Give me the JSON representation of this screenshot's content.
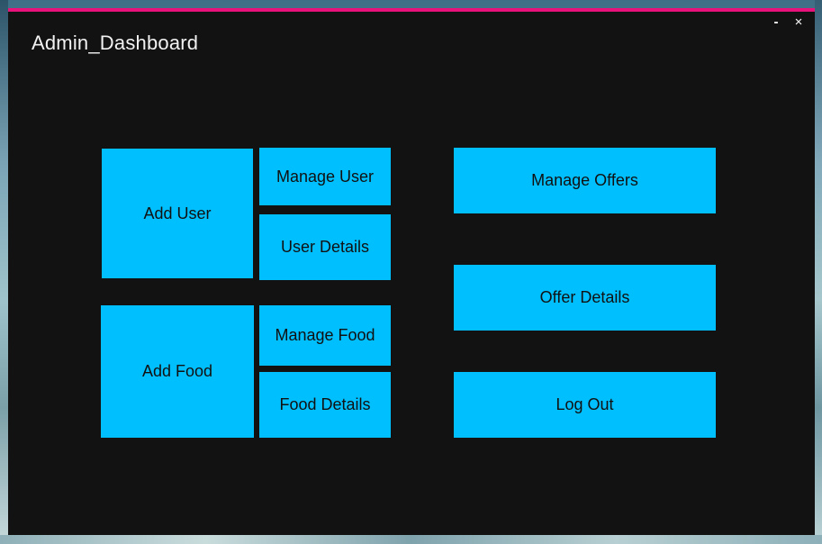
{
  "window": {
    "title": "Admin_Dashboard",
    "minimize_glyph": "-",
    "close_glyph": "×",
    "accent_color": "#e8127a"
  },
  "tiles": {
    "add_user": "Add User",
    "manage_user": "Manage User",
    "user_details": "User Details",
    "add_food": "Add Food",
    "manage_food": "Manage Food",
    "food_details": "Food Details",
    "manage_offers": "Manage Offers",
    "offer_details": "Offer Details",
    "log_out": "Log Out"
  },
  "colors": {
    "tile": "#00bfff",
    "window_background": "#121212"
  }
}
